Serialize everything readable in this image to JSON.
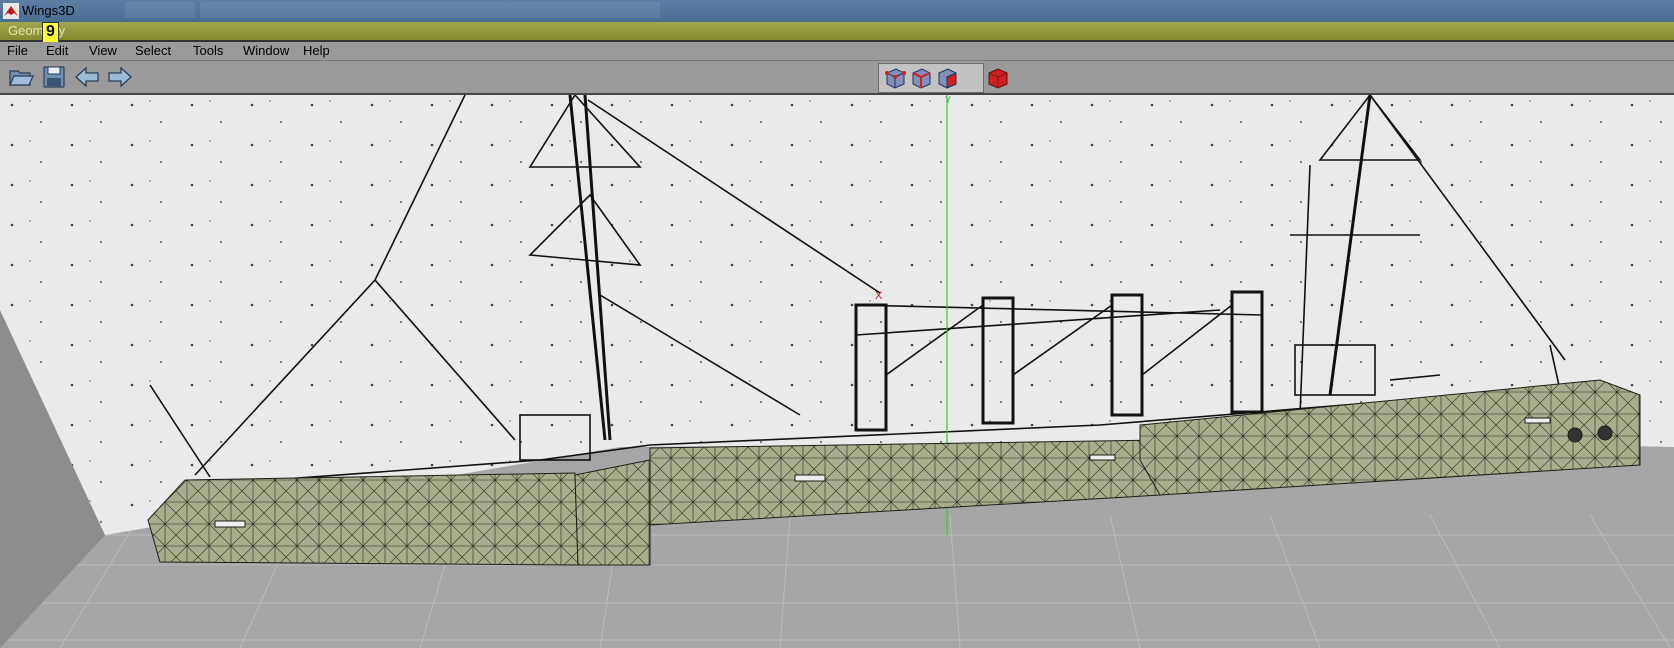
{
  "window": {
    "title": "Wings3D"
  },
  "geometry_window": {
    "label": "Geometry",
    "marker": "9"
  },
  "menu": {
    "items": [
      "File",
      "Edit",
      "View",
      "Select",
      "Tools",
      "Window",
      "Help"
    ]
  },
  "toolbar": {
    "left_buttons": [
      "open-folder-icon",
      "save-disk-icon",
      "undo-arrow-icon",
      "redo-arrow-icon"
    ],
    "select_modes": [
      "vertex-mode-icon",
      "edge-mode-icon",
      "face-mode-icon",
      "body-mode-icon"
    ]
  },
  "viewport": {
    "axis_y_label": "Y",
    "axis_x_label": "X"
  },
  "colors": {
    "title_bar": "#4b6d92",
    "geometry_bar": "#949a3c",
    "menu_bar": "#9a9a9a",
    "model_face": "#a4a88a",
    "grid_floor": "#9e9e9e",
    "y_axis": "#33cc33",
    "x_axis": "#cc2222",
    "body_mode": "#d02020"
  }
}
